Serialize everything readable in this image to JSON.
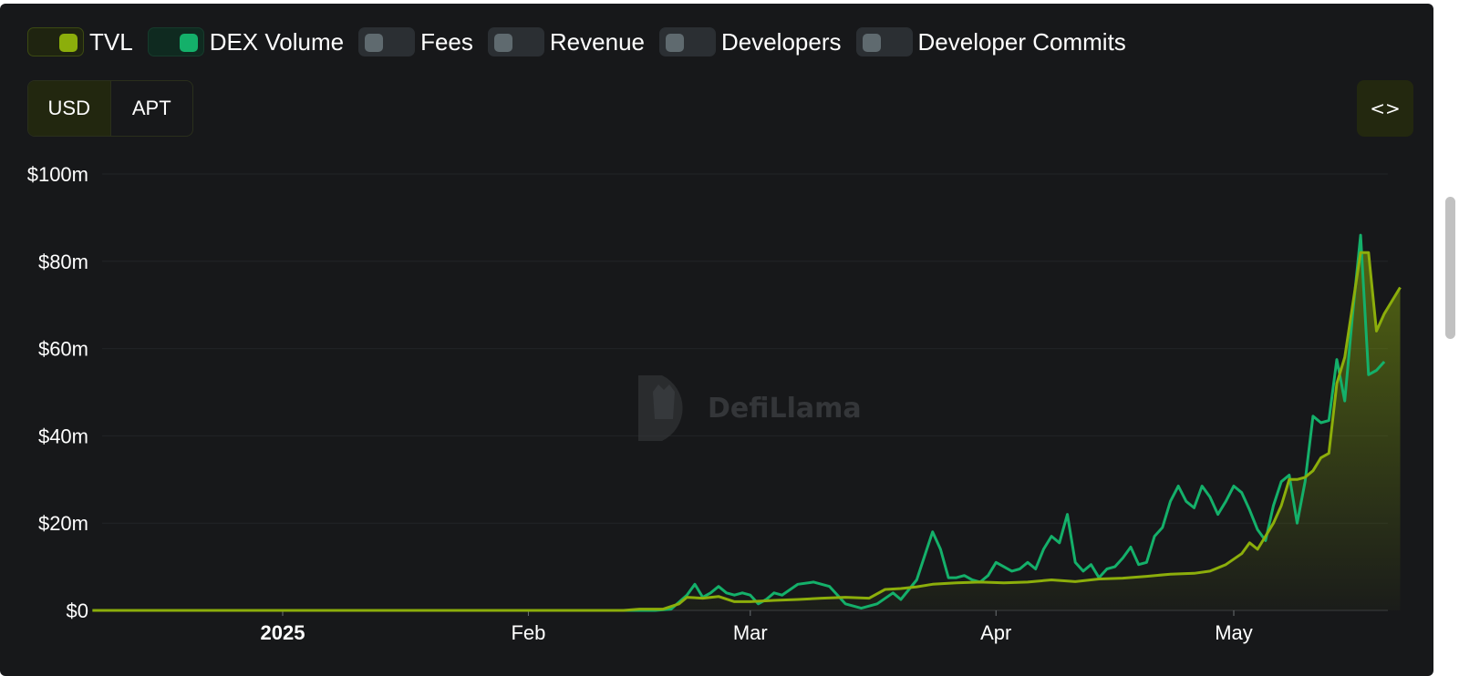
{
  "toggles": [
    {
      "label": "TVL",
      "on": true,
      "color": "#8cae0b"
    },
    {
      "label": "DEX Volume",
      "on": true,
      "color": "#14b06a"
    },
    {
      "label": "Fees",
      "on": false
    },
    {
      "label": "Revenue",
      "on": false
    },
    {
      "label": "Developers",
      "on": false
    },
    {
      "label": "Developer Commits",
      "on": false
    }
  ],
  "denomination": {
    "options": [
      "USD",
      "APT"
    ],
    "selected": "USD"
  },
  "embed_button": {
    "icon": "code-icon",
    "label": "<>"
  },
  "watermark": {
    "text": "DefiLlama"
  },
  "chart_data": {
    "type": "line",
    "title": "",
    "ylim": [
      0,
      100
    ],
    "yunit": "$m",
    "yticks": [
      0,
      20,
      40,
      60,
      80,
      100
    ],
    "ytick_labels": [
      "$0",
      "$20m",
      "$40m",
      "$60m",
      "$80m",
      "$100m"
    ],
    "xticks": [
      {
        "label": "2025",
        "date": "2025-01-01",
        "bold": true
      },
      {
        "label": "Feb",
        "date": "2025-02-01",
        "bold": false
      },
      {
        "label": "Mar",
        "date": "2025-03-01",
        "bold": false
      },
      {
        "label": "Apr",
        "date": "2025-04-01",
        "bold": false
      },
      {
        "label": "May",
        "date": "2025-05-01",
        "bold": false
      }
    ],
    "x_range": [
      "2024-12-08",
      "2025-05-19"
    ],
    "grid": true,
    "series": [
      {
        "name": "TVL",
        "color": "#8cae0b",
        "fill": true,
        "points": [
          [
            "2024-12-08",
            0
          ],
          [
            "2025-01-01",
            0
          ],
          [
            "2025-02-01",
            0
          ],
          [
            "2025-02-13",
            0
          ],
          [
            "2025-02-15",
            0.3
          ],
          [
            "2025-02-18",
            0.3
          ],
          [
            "2025-02-20",
            1.5
          ],
          [
            "2025-02-21",
            3
          ],
          [
            "2025-02-23",
            2.8
          ],
          [
            "2025-02-25",
            3.2
          ],
          [
            "2025-02-27",
            2
          ],
          [
            "2025-03-01",
            2
          ],
          [
            "2025-03-04",
            2.3
          ],
          [
            "2025-03-07",
            2.5
          ],
          [
            "2025-03-10",
            2.8
          ],
          [
            "2025-03-13",
            3
          ],
          [
            "2025-03-16",
            2.8
          ],
          [
            "2025-03-18",
            4.8
          ],
          [
            "2025-03-20",
            5
          ],
          [
            "2025-03-22",
            5.4
          ],
          [
            "2025-03-24",
            6
          ],
          [
            "2025-03-27",
            6.3
          ],
          [
            "2025-03-30",
            6.5
          ],
          [
            "2025-04-02",
            6.3
          ],
          [
            "2025-04-05",
            6.5
          ],
          [
            "2025-04-08",
            7
          ],
          [
            "2025-04-11",
            6.6
          ],
          [
            "2025-04-14",
            7.2
          ],
          [
            "2025-04-17",
            7.4
          ],
          [
            "2025-04-20",
            7.8
          ],
          [
            "2025-04-23",
            8.3
          ],
          [
            "2025-04-26",
            8.5
          ],
          [
            "2025-04-28",
            9
          ],
          [
            "2025-04-30",
            10.5
          ],
          [
            "2025-05-02",
            13
          ],
          [
            "2025-05-03",
            15.5
          ],
          [
            "2025-05-04",
            14
          ],
          [
            "2025-05-05",
            17
          ],
          [
            "2025-05-06",
            20
          ],
          [
            "2025-05-07",
            24
          ],
          [
            "2025-05-08",
            30
          ],
          [
            "2025-05-09",
            30
          ],
          [
            "2025-05-10",
            30.5
          ],
          [
            "2025-05-11",
            32
          ],
          [
            "2025-05-12",
            35
          ],
          [
            "2025-05-13",
            36
          ],
          [
            "2025-05-14",
            52
          ],
          [
            "2025-05-15",
            58
          ],
          [
            "2025-05-16",
            70
          ],
          [
            "2025-05-17",
            82
          ],
          [
            "2025-05-18",
            82
          ],
          [
            "2025-05-19",
            64
          ],
          [
            "2025-05-20",
            68
          ],
          [
            "2025-05-21",
            71
          ],
          [
            "2025-05-22",
            74
          ]
        ]
      },
      {
        "name": "DEX Volume",
        "color": "#14b06a",
        "fill": false,
        "points": [
          [
            "2024-12-08",
            0
          ],
          [
            "2025-02-17",
            0
          ],
          [
            "2025-02-19",
            0.3
          ],
          [
            "2025-02-21",
            3.5
          ],
          [
            "2025-02-22",
            6
          ],
          [
            "2025-02-23",
            3
          ],
          [
            "2025-02-24",
            4
          ],
          [
            "2025-02-25",
            5.5
          ],
          [
            "2025-02-26",
            4
          ],
          [
            "2025-02-27",
            3.5
          ],
          [
            "2025-02-28",
            4
          ],
          [
            "2025-03-01",
            3.5
          ],
          [
            "2025-03-02",
            1.5
          ],
          [
            "2025-03-03",
            2.5
          ],
          [
            "2025-03-04",
            4
          ],
          [
            "2025-03-05",
            3.5
          ],
          [
            "2025-03-07",
            6
          ],
          [
            "2025-03-09",
            6.5
          ],
          [
            "2025-03-11",
            5.5
          ],
          [
            "2025-03-13",
            1.5
          ],
          [
            "2025-03-15",
            0.5
          ],
          [
            "2025-03-17",
            1.5
          ],
          [
            "2025-03-19",
            4
          ],
          [
            "2025-03-20",
            2.5
          ],
          [
            "2025-03-22",
            7
          ],
          [
            "2025-03-24",
            18
          ],
          [
            "2025-03-25",
            14
          ],
          [
            "2025-03-26",
            7.5
          ],
          [
            "2025-03-27",
            7.5
          ],
          [
            "2025-03-28",
            8
          ],
          [
            "2025-03-29",
            7
          ],
          [
            "2025-03-30",
            6.5
          ],
          [
            "2025-03-31",
            8
          ],
          [
            "2025-04-01",
            11
          ],
          [
            "2025-04-02",
            10
          ],
          [
            "2025-04-03",
            9
          ],
          [
            "2025-04-04",
            9.5
          ],
          [
            "2025-04-05",
            11
          ],
          [
            "2025-04-06",
            9.5
          ],
          [
            "2025-04-07",
            14
          ],
          [
            "2025-04-08",
            17
          ],
          [
            "2025-04-09",
            15.5
          ],
          [
            "2025-04-10",
            22
          ],
          [
            "2025-04-11",
            11
          ],
          [
            "2025-04-12",
            9
          ],
          [
            "2025-04-13",
            10.5
          ],
          [
            "2025-04-14",
            7.5
          ],
          [
            "2025-04-15",
            9.5
          ],
          [
            "2025-04-16",
            10
          ],
          [
            "2025-04-17",
            12
          ],
          [
            "2025-04-18",
            14.5
          ],
          [
            "2025-04-19",
            10.5
          ],
          [
            "2025-04-20",
            11
          ],
          [
            "2025-04-21",
            17
          ],
          [
            "2025-04-22",
            19
          ],
          [
            "2025-04-23",
            25
          ],
          [
            "2025-04-24",
            28.5
          ],
          [
            "2025-04-25",
            25
          ],
          [
            "2025-04-26",
            23.5
          ],
          [
            "2025-04-27",
            28.5
          ],
          [
            "2025-04-28",
            26
          ],
          [
            "2025-04-29",
            22
          ],
          [
            "2025-04-30",
            25
          ],
          [
            "2025-05-01",
            28.5
          ],
          [
            "2025-05-02",
            27
          ],
          [
            "2025-05-03",
            23
          ],
          [
            "2025-05-04",
            18.5
          ],
          [
            "2025-05-05",
            16
          ],
          [
            "2025-05-06",
            24
          ],
          [
            "2025-05-07",
            29.5
          ],
          [
            "2025-05-08",
            31
          ],
          [
            "2025-05-09",
            20
          ],
          [
            "2025-05-10",
            29.5
          ],
          [
            "2025-05-11",
            44.5
          ],
          [
            "2025-05-12",
            43
          ],
          [
            "2025-05-13",
            43.5
          ],
          [
            "2025-05-14",
            57.5
          ],
          [
            "2025-05-15",
            48
          ],
          [
            "2025-05-16",
            68
          ],
          [
            "2025-05-17",
            86
          ],
          [
            "2025-05-18",
            54
          ],
          [
            "2025-05-19",
            55
          ],
          [
            "2025-05-20",
            57
          ]
        ]
      }
    ]
  }
}
